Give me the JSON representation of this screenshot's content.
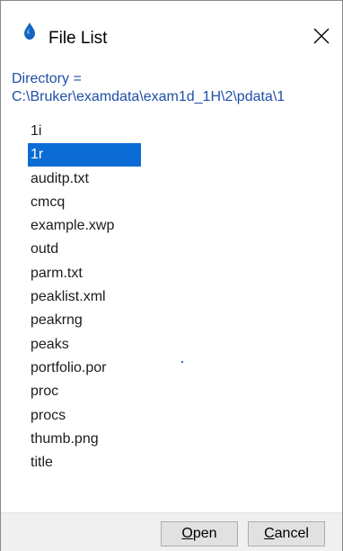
{
  "window": {
    "title": "File List",
    "app_icon": "topspin-drop-icon",
    "close_icon": "close-icon"
  },
  "directory": {
    "label": "Directory =",
    "path": "C:\\Bruker\\examdata\\exam1d_1H\\2\\pdata\\1"
  },
  "files": [
    {
      "name": "1i",
      "selected": false
    },
    {
      "name": "1r",
      "selected": true
    },
    {
      "name": "auditp.txt",
      "selected": false
    },
    {
      "name": "cmcq",
      "selected": false
    },
    {
      "name": "example.xwp",
      "selected": false
    },
    {
      "name": "outd",
      "selected": false
    },
    {
      "name": "parm.txt",
      "selected": false
    },
    {
      "name": "peaklist.xml",
      "selected": false
    },
    {
      "name": "peakrng",
      "selected": false
    },
    {
      "name": "peaks",
      "selected": false
    },
    {
      "name": "portfolio.por",
      "selected": false
    },
    {
      "name": "proc",
      "selected": false
    },
    {
      "name": "procs",
      "selected": false
    },
    {
      "name": "thumb.png",
      "selected": false
    },
    {
      "name": "title",
      "selected": false
    }
  ],
  "buttons": {
    "open": {
      "mnemonic": "O",
      "rest": "pen"
    },
    "cancel": {
      "mnemonic": "C",
      "rest": "ancel"
    }
  },
  "colors": {
    "selection": "#0a6cd4",
    "directory_text": "#1f4fa8"
  }
}
